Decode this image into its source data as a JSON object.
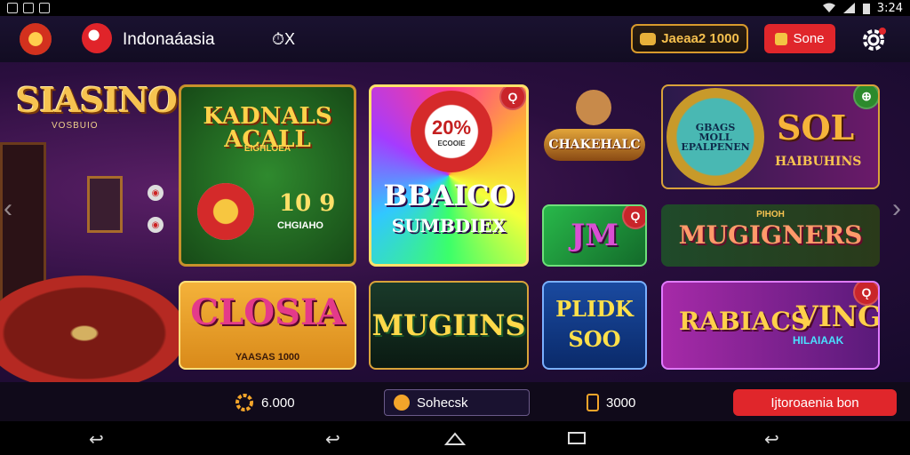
{
  "status_bar": {
    "time": "3:24"
  },
  "header": {
    "title": "Indonaáasia",
    "x_label": "⏱X",
    "coin_button": "Jaeaa2 1000",
    "red_button": "Sone"
  },
  "main": {
    "brand": "SIASINO",
    "brand_sub": "VOSBUIO",
    "tiles": [
      {
        "id": "kadnals",
        "title": "KADNALS ACALL",
        "sub": "EIGHLOEA",
        "extra": "10 9",
        "extra_sub": "CHGIAHO"
      },
      {
        "id": "baico",
        "title": "BBAICO",
        "sub": "SUMBDIEX",
        "chip": "20%",
        "chip_sub": "ECOOIE"
      },
      {
        "id": "chakehalc",
        "title": "CHAKEHALC"
      },
      {
        "id": "sol",
        "title": "SOL",
        "sub": "HAIBUHINS",
        "wheel": "GBAGS MOLL EPALPENEN"
      },
      {
        "id": "jm",
        "title": "JM"
      },
      {
        "id": "mugners",
        "title": "MUGIGNERS",
        "sub": "PIHOH"
      },
      {
        "id": "closia",
        "title": "CLOSIA",
        "sub": "YAASAS 1000"
      },
      {
        "id": "mugins",
        "title": "MUGIINS"
      },
      {
        "id": "plidk",
        "title": "PLIDK",
        "sub": "SOO"
      },
      {
        "id": "rabiacs",
        "title": "RABIACS",
        "sub": "VING",
        "extra": "HILAIAAK"
      }
    ],
    "colors": {
      "accent": "#e0262b",
      "gold": "#f6c350",
      "bg": "#160a2b"
    }
  },
  "bottom_bar": {
    "coins": "6.000",
    "search": "Sohecsk",
    "balance": "3000",
    "cta": "Ijtoroaenia bon"
  }
}
